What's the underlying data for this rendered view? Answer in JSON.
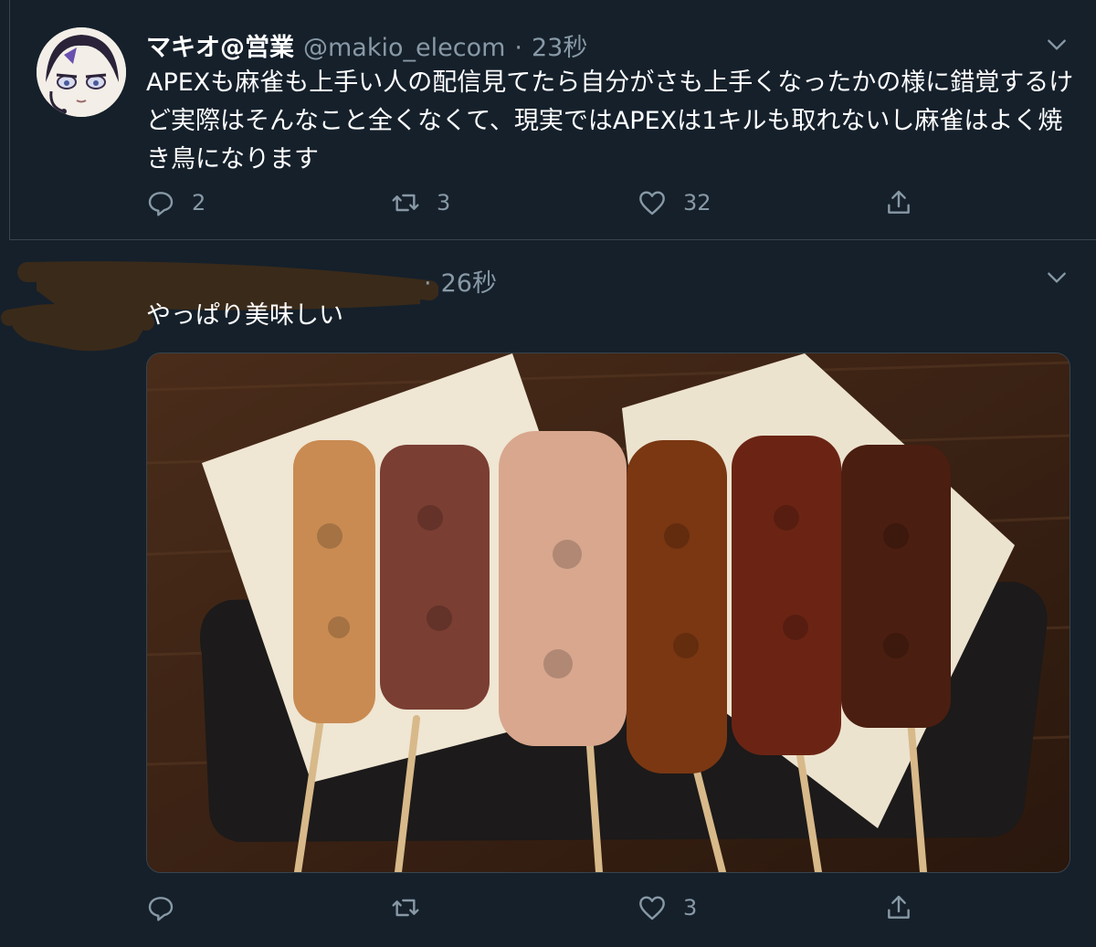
{
  "tweets": [
    {
      "display_name": "マキオ@営業",
      "handle": "@makio_elecom",
      "dot": "·",
      "time": "23秒",
      "text": "APEXも麻雀も上手い人の配信見てたら自分がさも上手くなったかの様に錯覚するけど実際はそんなこと全くなくて、現実ではAPEXは1キルも取れないし麻雀はよく焼き鳥になります",
      "replies": "2",
      "retweets": "3",
      "likes": "32"
    },
    {
      "dot": "·",
      "time": "26秒",
      "text": "やっぱり美味しい",
      "replies": "",
      "retweets": "",
      "likes": "3",
      "media_icon": "yakitori-photo"
    }
  ],
  "colors": {
    "background": "#15202b",
    "text": "#ffffff",
    "muted": "#8899a6",
    "border": "#38444d"
  },
  "icons": [
    "reply-icon",
    "retweet-icon",
    "like-icon",
    "share-icon",
    "chevron-down-icon"
  ]
}
